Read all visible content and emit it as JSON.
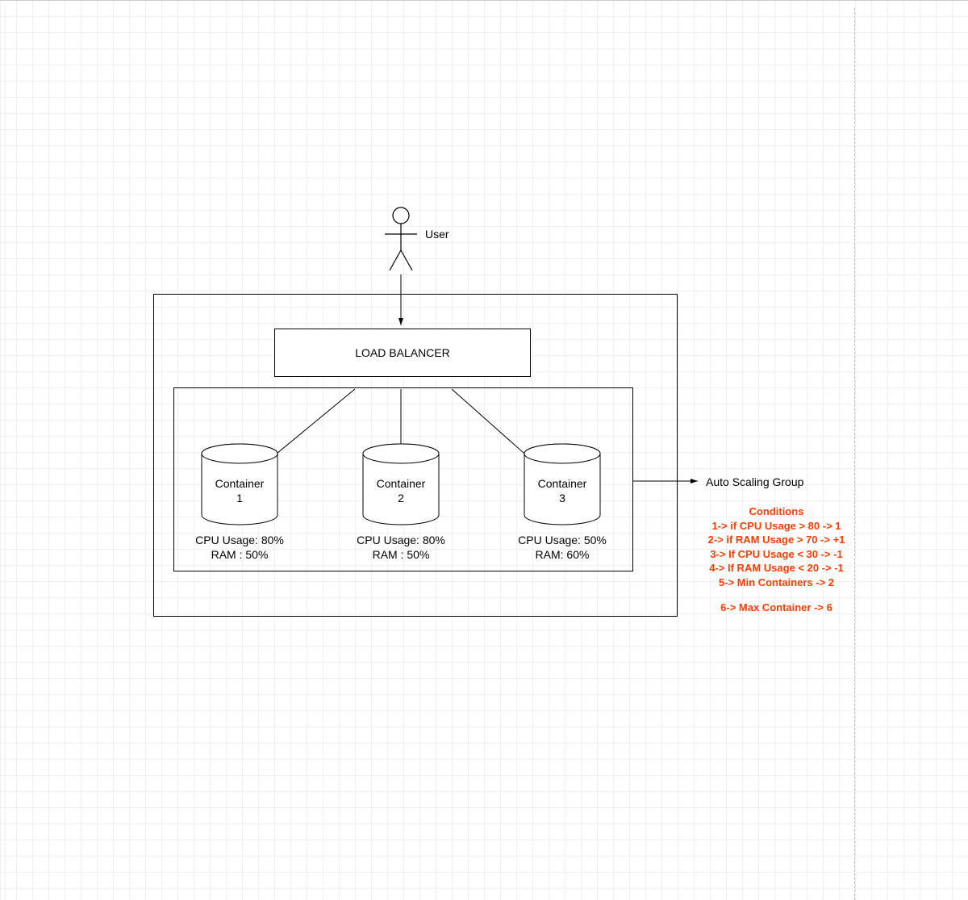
{
  "user_label": "User",
  "load_balancer": "LOAD BALANCER",
  "auto_scaling_label": "Auto Scaling Group",
  "containers": [
    {
      "name_l1": "Container",
      "name_l2": "1",
      "cpu": "CPU Usage: 80%",
      "ram": "RAM : 50%"
    },
    {
      "name_l1": "Container",
      "name_l2": "2",
      "cpu": "CPU Usage: 80%",
      "ram": "RAM : 50%"
    },
    {
      "name_l1": "Container",
      "name_l2": "3",
      "cpu": "CPU Usage: 50%",
      "ram": "RAM: 60%"
    }
  ],
  "conditions_title": "Conditions",
  "conditions": [
    "1-> if CPU Usage > 80 -> 1",
    "2-> if RAM Usage > 70 -> +1",
    "3-> If CPU Usage < 30 -> -1",
    "4-> If RAM Usage < 20 -> -1",
    "5-> Min Containers -> 2"
  ],
  "condition_last": "6-> Max Container -> 6"
}
